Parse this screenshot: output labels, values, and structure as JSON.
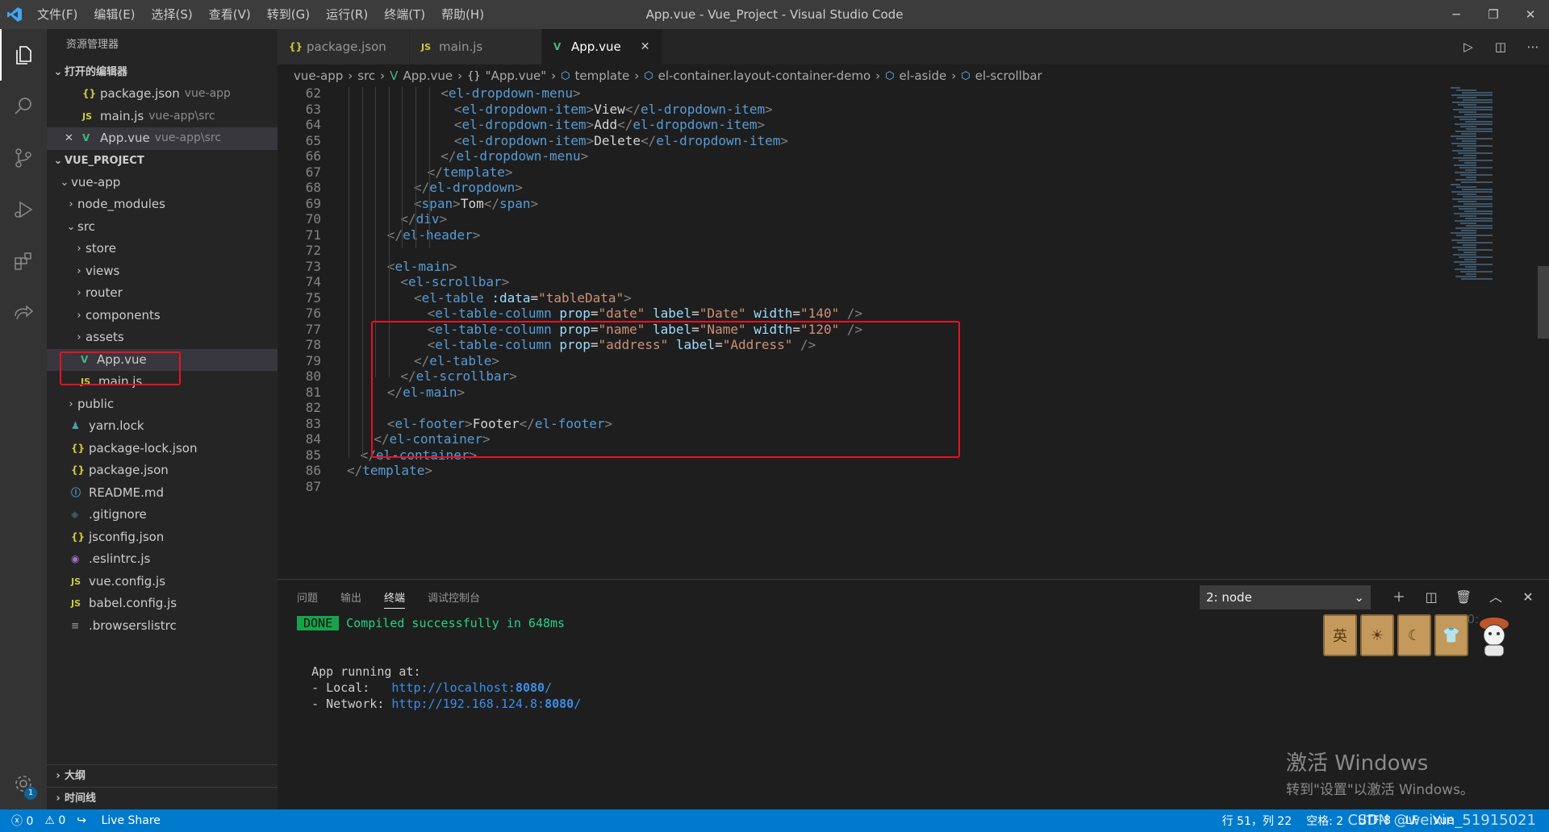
{
  "titlebar": {
    "menu": [
      "文件(F)",
      "编辑(E)",
      "选择(S)",
      "查看(V)",
      "转到(G)",
      "运行(R)",
      "终端(T)",
      "帮助(H)"
    ],
    "title": "App.vue - Vue_Project - Visual Studio Code",
    "minimize": "─",
    "restore": "❐",
    "close": "✕"
  },
  "activitybar": {
    "icons": [
      "files-icon",
      "search-icon",
      "source-control-icon",
      "run-debug-icon",
      "extensions-icon",
      "live-share-icon"
    ],
    "badge": "1"
  },
  "sidebar": {
    "header": "资源管理器",
    "open_editors_title": "打开的编辑器",
    "open_editors": [
      {
        "icon": "{}",
        "name": "package.json",
        "desc": "vue-app"
      },
      {
        "icon": "JS",
        "name": "main.js",
        "desc": "vue-app\\src"
      },
      {
        "icon": "V",
        "name": "App.vue",
        "desc": "vue-app\\src",
        "close": "✕"
      }
    ],
    "project_title": "VUE_PROJECT",
    "tree": {
      "vue_app": "vue-app",
      "node_modules": "node_modules",
      "src": "src",
      "store": "store",
      "views": "views",
      "router": "router",
      "components": "components",
      "assets": "assets",
      "app_vue": "App.vue",
      "main_js": "main.js",
      "public": "public",
      "yarn_lock": "yarn.lock",
      "package_lock": "package-lock.json",
      "package_json": "package.json",
      "readme": "README.md",
      "gitignore": ".gitignore",
      "jsconfig": "jsconfig.json",
      "eslintrc": ".eslintrc.js",
      "vue_config": "vue.config.js",
      "babel_config": "babel.config.js",
      "browserslistrc": ".browserslistrc"
    },
    "outline": "大纲",
    "timeline": "时间线"
  },
  "tabs": [
    {
      "icon": "{}",
      "label": "package.json"
    },
    {
      "icon": "JS",
      "label": "main.js"
    },
    {
      "icon": "V",
      "label": "App.vue",
      "close": "✕"
    }
  ],
  "breadcrumb": [
    "vue-app",
    "src",
    "App.vue",
    "\"App.vue\"",
    "template",
    "el-container.layout-container-demo",
    "el-aside",
    "el-scrollbar"
  ],
  "code": {
    "lines": [
      {
        "n": "62",
        "indent": 7,
        "tokens": [
          [
            "pun",
            "<"
          ],
          [
            "tag",
            "el-dropdown-menu"
          ],
          [
            "pun",
            ">"
          ]
        ]
      },
      {
        "n": "63",
        "indent": 8,
        "tokens": [
          [
            "pun",
            "<"
          ],
          [
            "tag",
            "el-dropdown-item"
          ],
          [
            "pun",
            ">"
          ],
          [
            "txt",
            "View"
          ],
          [
            "pun",
            "</"
          ],
          [
            "tag",
            "el-dropdown-item"
          ],
          [
            "pun",
            ">"
          ]
        ]
      },
      {
        "n": "64",
        "indent": 8,
        "tokens": [
          [
            "pun",
            "<"
          ],
          [
            "tag",
            "el-dropdown-item"
          ],
          [
            "pun",
            ">"
          ],
          [
            "txt",
            "Add"
          ],
          [
            "pun",
            "</"
          ],
          [
            "tag",
            "el-dropdown-item"
          ],
          [
            "pun",
            ">"
          ]
        ]
      },
      {
        "n": "65",
        "indent": 8,
        "tokens": [
          [
            "pun",
            "<"
          ],
          [
            "tag",
            "el-dropdown-item"
          ],
          [
            "pun",
            ">"
          ],
          [
            "txt",
            "Delete"
          ],
          [
            "pun",
            "</"
          ],
          [
            "tag",
            "el-dropdown-item"
          ],
          [
            "pun",
            ">"
          ]
        ]
      },
      {
        "n": "66",
        "indent": 7,
        "tokens": [
          [
            "pun",
            "</"
          ],
          [
            "tag",
            "el-dropdown-menu"
          ],
          [
            "pun",
            ">"
          ]
        ]
      },
      {
        "n": "67",
        "indent": 6,
        "tokens": [
          [
            "pun",
            "</"
          ],
          [
            "tag",
            "template"
          ],
          [
            "pun",
            ">"
          ]
        ]
      },
      {
        "n": "68",
        "indent": 5,
        "tokens": [
          [
            "pun",
            "</"
          ],
          [
            "tag",
            "el-dropdown"
          ],
          [
            "pun",
            ">"
          ]
        ]
      },
      {
        "n": "69",
        "indent": 5,
        "tokens": [
          [
            "pun",
            "<"
          ],
          [
            "tag",
            "span"
          ],
          [
            "pun",
            ">"
          ],
          [
            "txt",
            "Tom"
          ],
          [
            "pun",
            "</"
          ],
          [
            "tag",
            "span"
          ],
          [
            "pun",
            ">"
          ]
        ]
      },
      {
        "n": "70",
        "indent": 4,
        "tokens": [
          [
            "pun",
            "</"
          ],
          [
            "tag",
            "div"
          ],
          [
            "pun",
            ">"
          ]
        ]
      },
      {
        "n": "71",
        "indent": 3,
        "tokens": [
          [
            "pun",
            "</"
          ],
          [
            "tag",
            "el-header"
          ],
          [
            "pun",
            ">"
          ]
        ]
      },
      {
        "n": "72",
        "indent": 0,
        "tokens": []
      },
      {
        "n": "73",
        "indent": 3,
        "tokens": [
          [
            "pun",
            "<"
          ],
          [
            "tag",
            "el-main"
          ],
          [
            "pun",
            ">"
          ]
        ]
      },
      {
        "n": "74",
        "indent": 4,
        "tokens": [
          [
            "pun",
            "<"
          ],
          [
            "tag",
            "el-scrollbar"
          ],
          [
            "pun",
            ">"
          ]
        ]
      },
      {
        "n": "75",
        "indent": 5,
        "tokens": [
          [
            "pun",
            "<"
          ],
          [
            "tag",
            "el-table"
          ],
          [
            "txt",
            " "
          ],
          [
            "att",
            ":data"
          ],
          [
            "txt",
            "="
          ],
          [
            "str",
            "\"tableData\""
          ],
          [
            "pun",
            ">"
          ]
        ]
      },
      {
        "n": "76",
        "indent": 6,
        "tokens": [
          [
            "pun",
            "<"
          ],
          [
            "tag",
            "el-table-column"
          ],
          [
            "txt",
            " "
          ],
          [
            "att",
            "prop"
          ],
          [
            "txt",
            "="
          ],
          [
            "str",
            "\"date\""
          ],
          [
            "txt",
            " "
          ],
          [
            "att",
            "label"
          ],
          [
            "txt",
            "="
          ],
          [
            "str",
            "\"Date\""
          ],
          [
            "txt",
            " "
          ],
          [
            "att",
            "width"
          ],
          [
            "txt",
            "="
          ],
          [
            "str",
            "\"140\""
          ],
          [
            "txt",
            " "
          ],
          [
            "pun",
            "/>"
          ]
        ]
      },
      {
        "n": "77",
        "indent": 6,
        "tokens": [
          [
            "pun",
            "<"
          ],
          [
            "tag",
            "el-table-column"
          ],
          [
            "txt",
            " "
          ],
          [
            "att",
            "prop"
          ],
          [
            "txt",
            "="
          ],
          [
            "str",
            "\"name\""
          ],
          [
            "txt",
            " "
          ],
          [
            "att",
            "label"
          ],
          [
            "txt",
            "="
          ],
          [
            "str",
            "\"Name\""
          ],
          [
            "txt",
            " "
          ],
          [
            "att",
            "width"
          ],
          [
            "txt",
            "="
          ],
          [
            "str",
            "\"120\""
          ],
          [
            "txt",
            " "
          ],
          [
            "pun",
            "/>"
          ]
        ]
      },
      {
        "n": "78",
        "indent": 6,
        "tokens": [
          [
            "pun",
            "<"
          ],
          [
            "tag",
            "el-table-column"
          ],
          [
            "txt",
            " "
          ],
          [
            "att",
            "prop"
          ],
          [
            "txt",
            "="
          ],
          [
            "str",
            "\"address\""
          ],
          [
            "txt",
            " "
          ],
          [
            "att",
            "label"
          ],
          [
            "txt",
            "="
          ],
          [
            "str",
            "\"Address\""
          ],
          [
            "txt",
            " "
          ],
          [
            "pun",
            "/>"
          ]
        ]
      },
      {
        "n": "79",
        "indent": 5,
        "tokens": [
          [
            "pun",
            "</"
          ],
          [
            "tag",
            "el-table"
          ],
          [
            "pun",
            ">"
          ]
        ]
      },
      {
        "n": "80",
        "indent": 4,
        "tokens": [
          [
            "pun",
            "</"
          ],
          [
            "tag",
            "el-scrollbar"
          ],
          [
            "pun",
            ">"
          ]
        ]
      },
      {
        "n": "81",
        "indent": 3,
        "tokens": [
          [
            "pun",
            "</"
          ],
          [
            "tag",
            "el-main"
          ],
          [
            "pun",
            ">"
          ]
        ]
      },
      {
        "n": "82",
        "indent": 0,
        "tokens": []
      },
      {
        "n": "83",
        "indent": 3,
        "tokens": [
          [
            "pun",
            "<"
          ],
          [
            "tag",
            "el-footer"
          ],
          [
            "pun",
            ">"
          ],
          [
            "txt",
            "Footer"
          ],
          [
            "pun",
            "</"
          ],
          [
            "tag",
            "el-footer"
          ],
          [
            "pun",
            ">"
          ]
        ]
      },
      {
        "n": "84",
        "indent": 2,
        "tokens": [
          [
            "pun",
            "</"
          ],
          [
            "tag",
            "el-container"
          ],
          [
            "pun",
            ">"
          ]
        ]
      },
      {
        "n": "85",
        "indent": 1,
        "tokens": [
          [
            "pun",
            "</"
          ],
          [
            "tag",
            "el-container"
          ],
          [
            "pun",
            ">"
          ]
        ]
      },
      {
        "n": "86",
        "indent": 0,
        "tokens": [
          [
            "pun",
            "</"
          ],
          [
            "tag",
            "template"
          ],
          [
            "pun",
            ">"
          ]
        ]
      },
      {
        "n": "87",
        "indent": 0,
        "tokens": []
      }
    ]
  },
  "panel": {
    "tabs": [
      "问题",
      "输出",
      "终端",
      "调试控制台"
    ],
    "active_tab": "终端",
    "terminal_select": "2: node",
    "actions": [
      "＋",
      "◫",
      "🗑",
      "︿",
      "✕"
    ],
    "time": "20:",
    "terminal": {
      "done": "DONE",
      "compiled": "Compiled successfully in 648ms",
      "app_running": "App running at:",
      "local_label": "- Local:   ",
      "local_url": "http://localhost:",
      "local_port": "8080",
      "network_label": "- Network: ",
      "network_url": "http://192.168.124.8:",
      "network_port": "8080"
    }
  },
  "watermark": {
    "activate_title": "激活 Windows",
    "activate_sub": "转到\"设置\"以激活 Windows。",
    "csdn": "CSDN @weixin_51915021"
  },
  "deco": {
    "cards": [
      "英",
      "☀",
      "☾",
      "👕"
    ]
  },
  "statusbar": {
    "errors": "ⓧ 0",
    "warnings": "⚠ 0",
    "live_share": "Live Share",
    "position": "行 51，列 22",
    "spaces": "空格: 2",
    "encoding": "UTF-8",
    "eol": "LF",
    "language": "Vue"
  }
}
